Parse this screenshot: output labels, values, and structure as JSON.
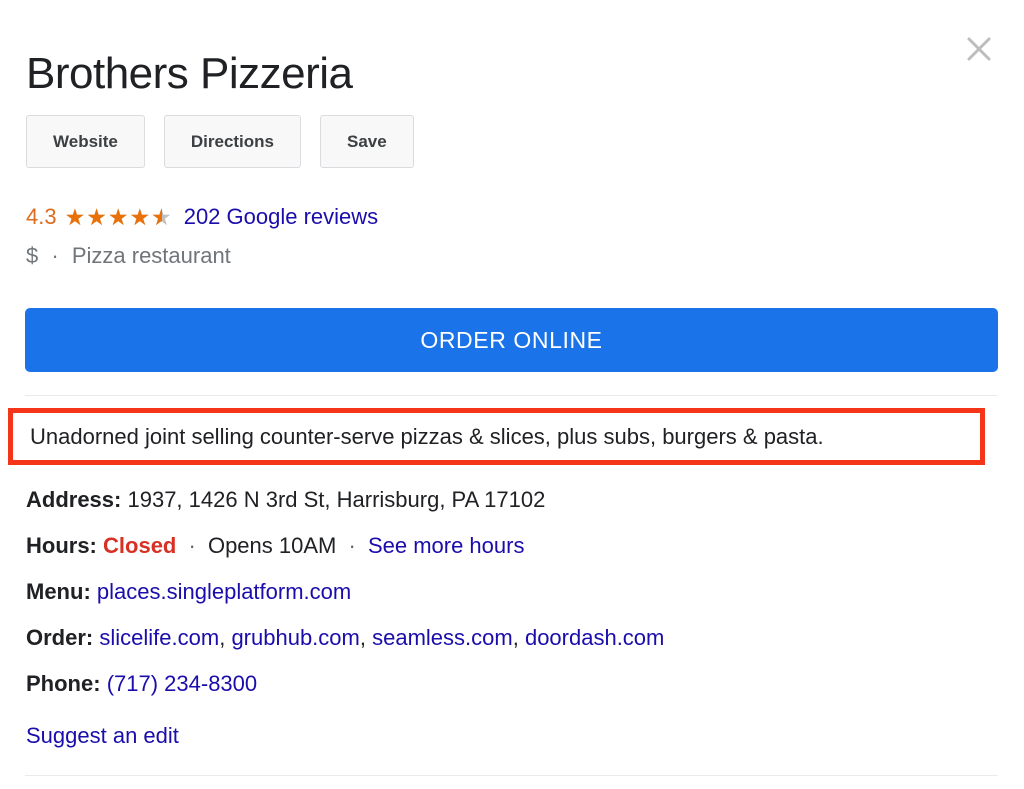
{
  "panel": {
    "title": "Brothers Pizzeria",
    "close_icon": "close-icon"
  },
  "actions": [
    {
      "label": "Website",
      "name": "website-button"
    },
    {
      "label": "Directions",
      "name": "directions-button"
    },
    {
      "label": "Save",
      "name": "save-button"
    }
  ],
  "rating": {
    "value": "4.3",
    "stars_filled": 4.5,
    "stars_total": 5,
    "reviews_label": "202 Google reviews",
    "star_color": "#e8710a",
    "value_color": "#dd6b20",
    "link_color": "#1a0dab"
  },
  "meta": {
    "price_level": "$",
    "separator": "·",
    "category": "Pizza restaurant"
  },
  "order_button": {
    "label": "ORDER ONLINE",
    "background": "#1a73e8",
    "text_color": "#ffffff"
  },
  "description": {
    "text": "Unadorned joint selling counter-serve pizzas & slices, plus subs, burgers & pasta.",
    "highlight_color": "#f4351a"
  },
  "details": {
    "address": {
      "label": "Address:",
      "value": "1937, 1426 N 3rd St, Harrisburg, PA 17102"
    },
    "hours": {
      "label": "Hours:",
      "status": "Closed",
      "status_color": "#d93025",
      "separator1": "·",
      "opens": "Opens 10AM",
      "separator2": "·",
      "more_link": "See more hours"
    },
    "menu": {
      "label": "Menu:",
      "link": "places.singleplatform.com"
    },
    "order": {
      "label": "Order:",
      "links": [
        "slicelife.com",
        "grubhub.com",
        "seamless.com",
        "doordash.com"
      ]
    },
    "phone": {
      "label": "Phone:",
      "number": "(717) 234-8300"
    }
  },
  "suggest_edit": {
    "label": "Suggest an edit"
  }
}
